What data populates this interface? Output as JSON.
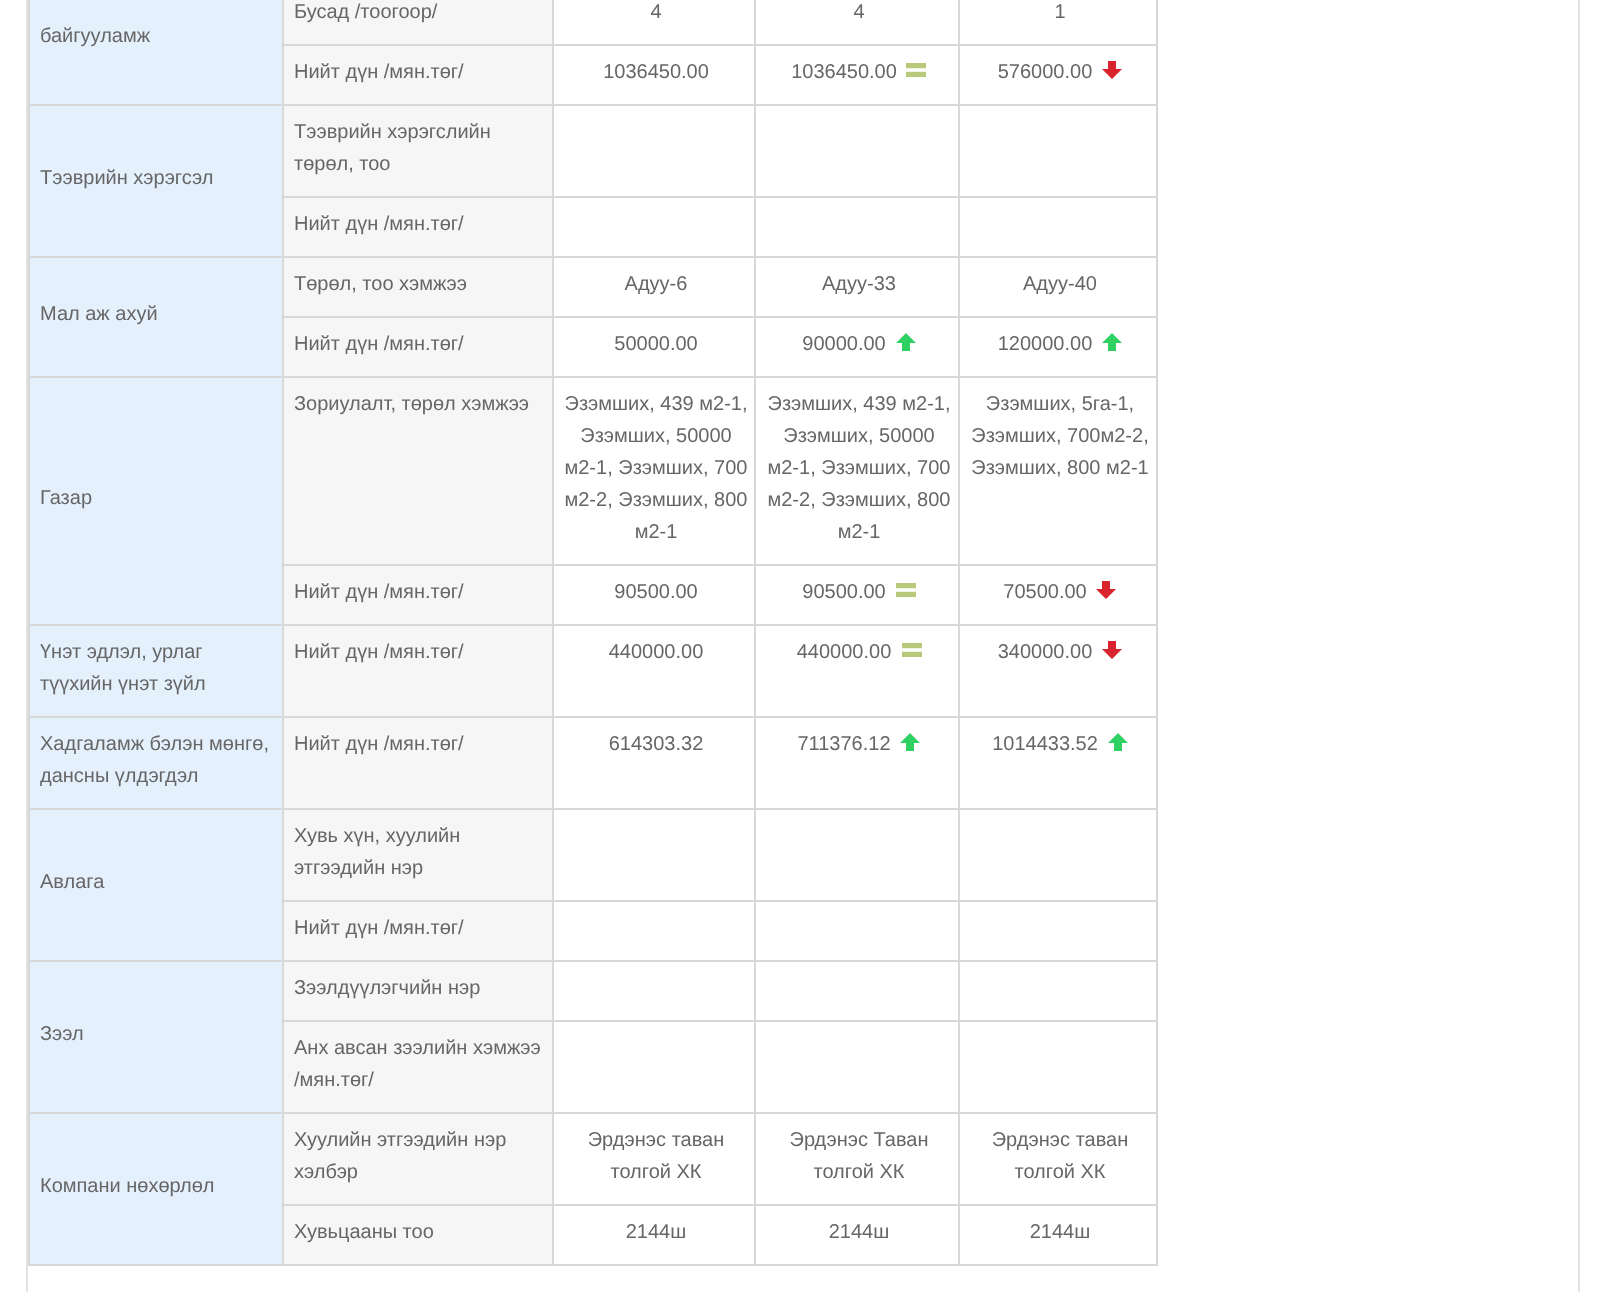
{
  "groups": [
    {
      "label": "байгууламж",
      "rows": [
        {
          "label": "Бусад /тоогоор/",
          "values": [
            {
              "text": "4"
            },
            {
              "text": "4"
            },
            {
              "text": "1"
            }
          ]
        },
        {
          "label": "Нийт дүн /мян.төг/",
          "values": [
            {
              "text": "1036450.00"
            },
            {
              "text": "1036450.00",
              "kind": "same"
            },
            {
              "text": "576000.00",
              "kind": "down"
            }
          ]
        }
      ]
    },
    {
      "label": "Тээврийн хэрэгсэл",
      "rows": [
        {
          "label": "Тээврийн хэрэгслийн төрөл, тоо"
        },
        {
          "label": "Нийт дүн /мян.төг/"
        }
      ]
    },
    {
      "label": "Мал аж ахуй",
      "rows": [
        {
          "label": "Төрөл, тоо хэмжээ",
          "values": [
            {
              "text": "Адуу-6"
            },
            {
              "text": "Адуу-33"
            },
            {
              "text": "Адуу-40"
            }
          ]
        },
        {
          "label": "Нийт дүн /мян.төг/",
          "values": [
            {
              "text": "50000.00"
            },
            {
              "text": "90000.00",
              "kind": "up"
            },
            {
              "text": "120000.00",
              "kind": "up"
            }
          ]
        }
      ]
    },
    {
      "label": "Газар",
      "rows": [
        {
          "label": "Зориулалт, төрөл хэмжээ",
          "values": [
            {
              "text": "Эзэмших, 439 м2-1, Эзэмших, 50000 м2-1, Эзэмших, 700 м2-2, Эзэмших, 800 м2-1"
            },
            {
              "text": "Эзэмших, 439 м2-1, Эзэмших, 50000 м2-1, Эзэмших, 700 м2-2, Эзэмших, 800 м2-1"
            },
            {
              "text": "Эзэмших, 5га-1, Эзэмших, 700м2-2, Эзэмших, 800 м2-1"
            }
          ]
        },
        {
          "label": "Нийт дүн /мян.төг/",
          "values": [
            {
              "text": "90500.00"
            },
            {
              "text": "90500.00",
              "kind": "same"
            },
            {
              "text": "70500.00",
              "kind": "down"
            }
          ]
        }
      ]
    },
    {
      "label": "Үнэт эдлэл, урлаг түүхийн үнэт зүйл",
      "rows": [
        {
          "label": "Нийт дүн /мян.төг/",
          "values": [
            {
              "text": "440000.00"
            },
            {
              "text": "440000.00",
              "kind": "same"
            },
            {
              "text": "340000.00",
              "kind": "down"
            }
          ]
        }
      ]
    },
    {
      "label": "Хадгаламж бэлэн мөнгө, дансны үлдэгдэл",
      "rows": [
        {
          "label": "Нийт дүн /мян.төг/",
          "values": [
            {
              "text": "614303.32"
            },
            {
              "text": "711376.12",
              "kind": "up"
            },
            {
              "text": "1014433.52",
              "kind": "up"
            }
          ]
        }
      ]
    },
    {
      "label": "Авлага",
      "rows": [
        {
          "label": "Хувь хүн, хуулийн этгээдийн нэр"
        },
        {
          "label": "Нийт дүн /мян.төг/"
        }
      ]
    },
    {
      "label": "Зээл",
      "rows": [
        {
          "label": "Зээлдүүлэгчийн нэр"
        },
        {
          "label": "Анх авсан зээлийн хэмжээ /мян.төг/"
        }
      ]
    },
    {
      "label": "Компани нөхөрлөл",
      "rows": [
        {
          "label": "Хуулийн этгээдийн нэр хэлбэр",
          "values": [
            {
              "text": "Эрдэнэс таван толгой ХК"
            },
            {
              "text": "Эрдэнэс Таван толгой ХК"
            },
            {
              "text": "Эрдэнэс таван толгой ХК"
            }
          ]
        },
        {
          "label": "Хувьцааны тоо",
          "values": [
            {
              "text": "2144ш"
            },
            {
              "text": "2144ш"
            },
            {
              "text": "2144ш"
            }
          ]
        }
      ]
    }
  ]
}
